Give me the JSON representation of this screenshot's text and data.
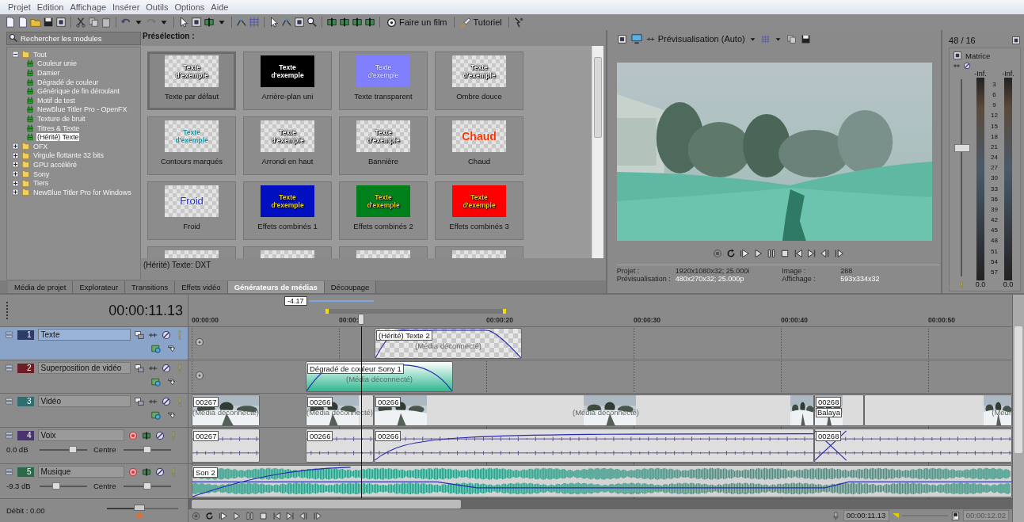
{
  "menu": [
    "Projet",
    "Edition",
    "Affichage",
    "Insérer",
    "Outils",
    "Options",
    "Aide"
  ],
  "toolbar": {
    "film_button": "Faire un film",
    "tutorial_button": "Tutoriel"
  },
  "modules": {
    "search": {
      "placeholder": "Rechercher les modules"
    },
    "tree": [
      {
        "label": "Tout",
        "expanded": true,
        "selected": false,
        "children": [
          {
            "label": "Couleur unie",
            "selected": false
          },
          {
            "label": "Damier",
            "selected": false
          },
          {
            "label": "Dégradé de couleur",
            "selected": false
          },
          {
            "label": "Générique de fin déroulant",
            "selected": false
          },
          {
            "label": "Motif de test",
            "selected": false
          },
          {
            "label": "NewBlue Titler Pro - OpenFX",
            "selected": false
          },
          {
            "label": "Texture de bruit",
            "selected": false
          },
          {
            "label": "Titres & Texte",
            "selected": false
          },
          {
            "label": "(Hérité) Texte",
            "selected": true
          }
        ]
      },
      {
        "label": "OFX",
        "expanded": false,
        "selected": false
      },
      {
        "label": "Virgule flottante 32 bits",
        "expanded": false,
        "selected": false
      },
      {
        "label": "GPU accéléré",
        "expanded": false,
        "selected": false
      },
      {
        "label": "Sony",
        "expanded": false,
        "selected": false
      },
      {
        "label": "Tiers",
        "expanded": false,
        "selected": false
      },
      {
        "label": "NewBlue Titler Pro for Windows",
        "expanded": false,
        "selected": false
      }
    ]
  },
  "presets": {
    "title": "Présélection :",
    "items": [
      {
        "label": "Texte par défaut",
        "sample": "Texte d'exemple",
        "kind": "plain",
        "selected": true
      },
      {
        "label": "Arrière-plan uni",
        "sample": "Texte d'exemple",
        "kind": "black",
        "selected": false
      },
      {
        "label": "Texte transparent",
        "sample": "Texte d'exemple",
        "kind": "transparent",
        "selected": false
      },
      {
        "label": "Ombre douce",
        "sample": "Texte d'exemple",
        "kind": "shadow",
        "selected": false
      },
      {
        "label": "Contours marqués",
        "sample": "Texte d'exemple",
        "kind": "outline",
        "selected": false
      },
      {
        "label": "Arrondi en haut",
        "sample": "Texte d'exemple",
        "kind": "arc",
        "selected": false
      },
      {
        "label": "Bannière",
        "sample": "Texte d'exemple",
        "kind": "banner",
        "selected": false
      },
      {
        "label": "Chaud",
        "sample": "Chaud",
        "kind": "hot",
        "selected": false
      },
      {
        "label": "Froid",
        "sample": "Froid",
        "kind": "cold",
        "selected": false
      },
      {
        "label": "Effets combinés 1",
        "sample": "Texte d'exemple",
        "kind": "combo",
        "selected": false
      },
      {
        "label": "Effets combinés 2",
        "sample": "Texte d'exemple",
        "kind": "combo",
        "selected": false
      },
      {
        "label": "Effets combinés 3",
        "sample": "Texte d'exemple",
        "kind": "combo",
        "selected": false
      },
      {
        "kind": "partial",
        "selected": false
      },
      {
        "kind": "partial",
        "selected": false
      },
      {
        "kind": "partial",
        "selected": false
      },
      {
        "kind": "partial",
        "selected": false
      }
    ],
    "status": "(Hérité) Texte: DXT"
  },
  "dock_tabs": [
    {
      "label": "Média de projet",
      "selected": false
    },
    {
      "label": "Explorateur",
      "selected": false
    },
    {
      "label": "Transitions",
      "selected": false
    },
    {
      "label": "Effets vidéo",
      "selected": false
    },
    {
      "label": "Générateurs de médias",
      "selected": true
    },
    {
      "label": "Découpage",
      "selected": false
    }
  ],
  "preview": {
    "mode": "Prévisualisation (Auto)",
    "info": [
      {
        "label": "Projet :",
        "value": "1920x1080x32; 25.000i",
        "highlighted": false
      },
      {
        "label": "Prévisualisation :",
        "value": "480x270x32; 25.000p",
        "highlighted": true
      },
      {
        "label": "Image :",
        "value": "288",
        "highlighted": false
      },
      {
        "label": "Affichage :",
        "value": "593x334x32",
        "highlighted": true
      }
    ]
  },
  "meter": {
    "channels": "48 / 16",
    "mode": "Matrice",
    "peaks": [
      "-Inf.",
      "-Inf."
    ],
    "scale": [
      "3",
      "6",
      "9",
      "12",
      "15",
      "18",
      "21",
      "24",
      "27",
      "30",
      "33",
      "36",
      "39",
      "42",
      "45",
      "48",
      "51",
      "54",
      "57"
    ],
    "readings": [
      "0.0",
      "0.0"
    ],
    "fader": {
      "level": 0.65
    }
  },
  "timeline": {
    "time": "00:00:11.13",
    "marker": "-4.17",
    "ruler": [
      "00:00:00",
      "00:00:",
      "00:00:20",
      "00:00:30",
      "00:00:40",
      "00:00:50"
    ],
    "tracks": [
      {
        "number": "1",
        "name": "Texte",
        "color": "#2e3b66",
        "kind": "video",
        "selected": true,
        "clips": [
          {
            "kind": "text",
            "label": "(Hérité) Texte 2",
            "note": "(Média déconnecté)"
          }
        ]
      },
      {
        "number": "2",
        "name": "Superposition de vidéo",
        "color": "#6b1f24",
        "kind": "video",
        "selected": false,
        "clips": [
          {
            "kind": "generated",
            "label": "Dégradé de couleur Sony 1",
            "note": "(Média déconnecté)"
          }
        ]
      },
      {
        "number": "3",
        "name": "Vidéo",
        "color": "#2d6f70",
        "kind": "video",
        "selected": false,
        "clips": [
          {
            "kind": "video",
            "label": "00267",
            "note": "(Média déconnecté)"
          },
          {
            "kind": "video",
            "label": "00266",
            "note": "(Média déconnecté)"
          },
          {
            "kind": "video",
            "label": "00266",
            "note": "(Média déconnecté)"
          },
          {
            "kind": "video",
            "label": "00268",
            "note": "Balaya"
          },
          {
            "kind": "video",
            "note": "(Médi"
          }
        ]
      },
      {
        "number": "4",
        "name": "Voix",
        "color": "#4a3470",
        "kind": "audio",
        "selected": false,
        "volume": {
          "reading": "0.0 dB",
          "level": 0.7
        },
        "pan": {
          "reading": "Centre",
          "level": 0.5
        },
        "clips": [
          {
            "kind": "voice",
            "label": "00267"
          },
          {
            "kind": "voice",
            "label": "00266"
          },
          {
            "kind": "voice",
            "label": "00266"
          },
          {
            "kind": "voice",
            "label": "00268"
          }
        ]
      },
      {
        "number": "5",
        "name": "Musique",
        "color": "#2a6a4a",
        "kind": "audio",
        "selected": false,
        "volume": {
          "reading": "-9.3 dB",
          "level": 0.35
        },
        "pan": {
          "reading": "Centre",
          "level": 0.5
        },
        "clips": [
          {
            "kind": "music",
            "label": "Son 2"
          }
        ]
      }
    ],
    "rate": "Débit : 0.00",
    "rate_slider": {
      "level": 0.46
    },
    "cursor_time": "00:00:11.13",
    "end_time": "00:00:12.02"
  }
}
